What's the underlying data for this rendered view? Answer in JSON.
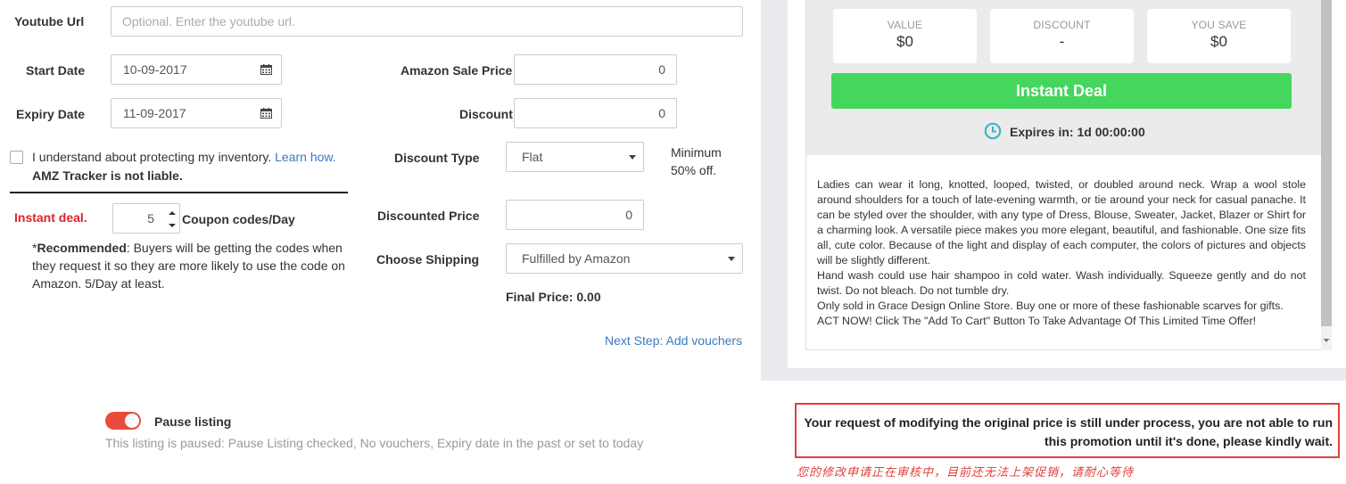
{
  "form": {
    "youtube": {
      "label": "Youtube Url",
      "placeholder": "Optional. Enter the youtube url."
    },
    "start_date": {
      "label": "Start Date",
      "value": "10-09-2017"
    },
    "expiry_date": {
      "label": "Expiry Date",
      "value": "11-09-2017"
    },
    "amazon_sale_price": {
      "label": "Amazon Sale Price",
      "value": "0"
    },
    "discount": {
      "label": "Discount",
      "value": "0"
    },
    "discount_type": {
      "label": "Discount Type",
      "value": "Flat",
      "hint_line1": "Minimum",
      "hint_line2": "50% off."
    },
    "discounted_price": {
      "label": "Discounted Price",
      "value": "0"
    },
    "choose_shipping": {
      "label": "Choose Shipping",
      "value": "Fulfilled by Amazon"
    },
    "final_price": "Final Price: 0.00",
    "inventory": {
      "text": "I understand about protecting my inventory.",
      "link": "Learn how.",
      "bold": "AMZ Tracker is not liable."
    },
    "instant_deal": {
      "label": "Instant deal.",
      "value": "5",
      "unit": "Coupon codes/Day"
    },
    "recommended": {
      "bold": "Recommended",
      "prefix": "*",
      "text": ": Buyers will be getting the codes when they request it so they are more likely to use the code on Amazon. 5/Day at least."
    },
    "next_step": "Next Step: Add vouchers"
  },
  "preview": {
    "stats": [
      {
        "title": "VALUE",
        "value": "$0"
      },
      {
        "title": "DISCOUNT",
        "value": "-"
      },
      {
        "title": "YOU SAVE",
        "value": "$0"
      }
    ],
    "deal_button": "Instant Deal",
    "expires": "Expires in: 1d 00:00:00",
    "description": [
      "Ladies can wear it long, knotted, looped, twisted, or doubled around neck. Wrap a wool stole around shoulders for a touch of late-evening warmth, or tie around your neck for casual panache. It can be styled over the shoulder, with any type of Dress, Blouse, Sweater, Jacket, Blazer or Shirt for a charming look. A versatile piece makes you more elegant, beautiful, and fashionable. One size fits all, cute color. Because of the light and display of each computer, the colors of pictures and objects will be slightly different.",
      "Hand wash could use hair shampoo in cold water. Wash individually. Squeeze gently and do not twist. Do not bleach. Do not tumble dry.",
      "Only sold in Grace Design Online Store. Buy one or more of these fashionable scarves for gifts.",
      "ACT NOW! Click The \"Add To Cart\" Button To Take Advantage Of This Limited Time Offer!"
    ],
    "colors": {
      "deal_green": "#44d65d",
      "clock_teal": "#3cb6c8"
    }
  },
  "bottom": {
    "pause_label": "Pause listing",
    "pause_hint": "This listing is paused: Pause Listing checked, No vouchers, Expiry date in the past or set to today",
    "warning": "Your request of modifying the original price is still under process, you are not able to run this promotion until it's done, please kindly wait.",
    "warning_cn": "您的修改申请正在审核中，目前还无法上架促销，请耐心等待",
    "colors": {
      "toggle_on": "#e84b3c",
      "warning_border": "#e0403a",
      "warning_cn": "#e0403a"
    }
  }
}
